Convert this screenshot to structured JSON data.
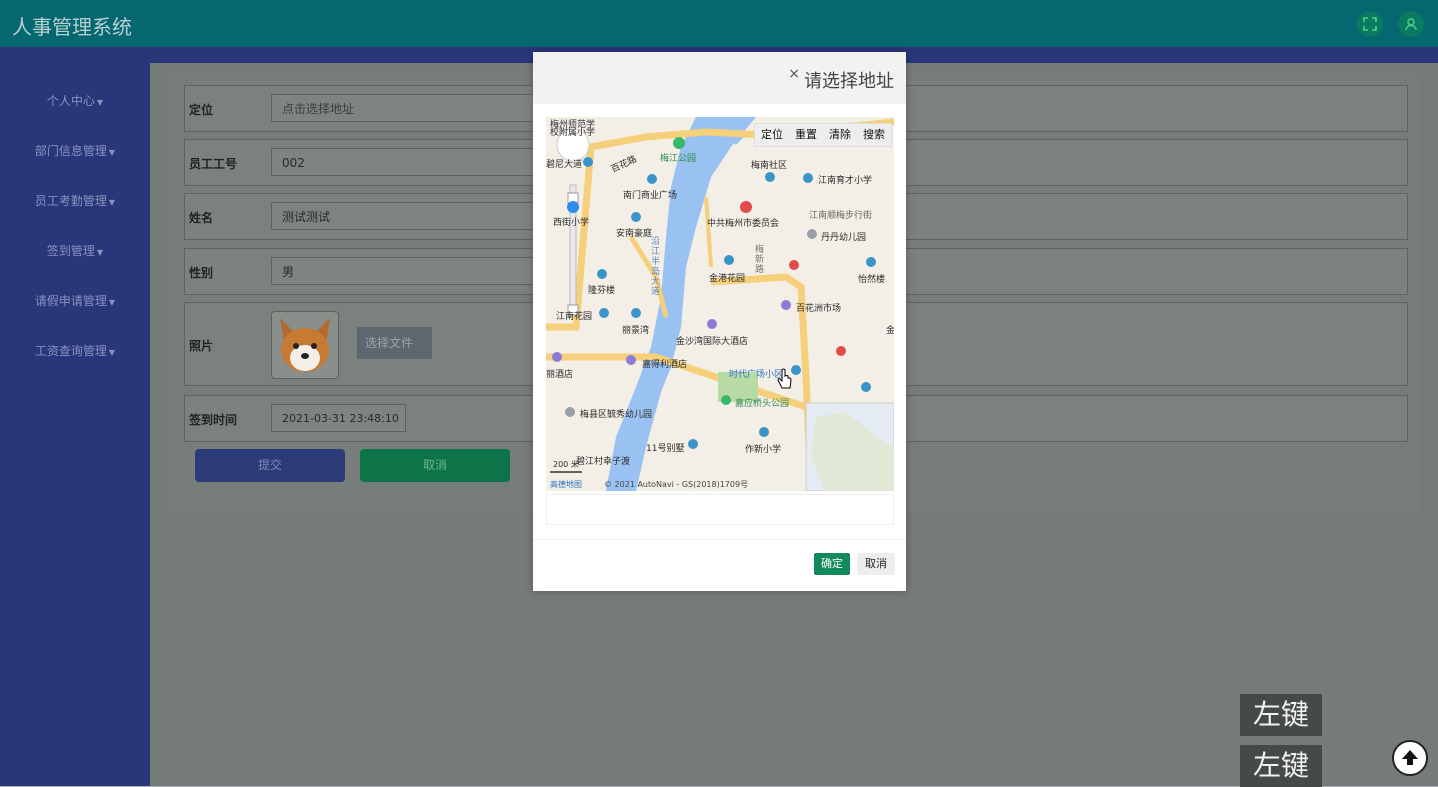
{
  "app": {
    "title": "人事管理系统"
  },
  "header_icons": [
    {
      "icon": "fullscreen-icon"
    },
    {
      "icon": "user-icon"
    }
  ],
  "sidebar": {
    "items": [
      {
        "label": "个人中心"
      },
      {
        "label": "部门信息管理"
      },
      {
        "label": "员工考勤管理"
      },
      {
        "label": "签到管理"
      },
      {
        "label": "请假申请管理"
      },
      {
        "label": "工资查询管理"
      }
    ]
  },
  "form": {
    "location": {
      "label": "定位",
      "placeholder": "点击选择地址"
    },
    "employee_no": {
      "label": "员工工号",
      "value": "002"
    },
    "name": {
      "label": "姓名",
      "value": "测试测试"
    },
    "gender": {
      "label": "性别",
      "value": "男"
    },
    "photo": {
      "label": "照片",
      "file_button": "选择文件"
    },
    "signin_time": {
      "label": "签到时间",
      "value": "2021-03-31 23:48:10"
    },
    "submit": "提交",
    "cancel": "取消"
  },
  "modal": {
    "title": "请选择地址",
    "close": "×",
    "map_tools": [
      "定位",
      "重置",
      "清除",
      "搜索"
    ],
    "map_labels": {
      "l1": "梅州师范学",
      "l2": "校附属小学",
      "l3": "碧尼大道",
      "l4": "百花路",
      "l5": "梅江公园",
      "l6": "梅南社区",
      "l7": "江南育才小学",
      "l8": "南门商业广场",
      "l9": "西街小学",
      "l10": "安南豪庭",
      "l11": "中共梅州市委员会",
      "l12": "江南顺梅步行街",
      "l13": "丹丹幼儿园",
      "l14": "金港花园",
      "l15": "梅新路",
      "l16": "隆芬楼",
      "l17": "怡然楼",
      "l18": "百花洲市场",
      "l19": "江南花园",
      "l20": "丽景湾",
      "l21": "金沙湾国际大酒店",
      "l22": "嘉得利酒店",
      "l23": "时代广场小区",
      "l24": "丽酒店",
      "l25": "梅县区毓秀幼儿园",
      "l26": "嘉应桥头公园",
      "l27": "11号别墅",
      "l28": "作新小学",
      "l29": "碧江村幸子渡",
      "l30": "沿江半岛大道",
      "l31": "金"
    },
    "scale": "200 米",
    "copyright": "© 2021 AutoNavi - GS(2018)1709号",
    "brand": "高德地图",
    "address_value": "",
    "ok": "确定",
    "cancel": "取消"
  },
  "key_hints": [
    "左键",
    "左键"
  ],
  "colors": {
    "topbar": "#056770",
    "sidebar": "#29377a",
    "ok_button": "#138a5a",
    "submit": "#2a3b78",
    "cancel": "#0c7448"
  }
}
